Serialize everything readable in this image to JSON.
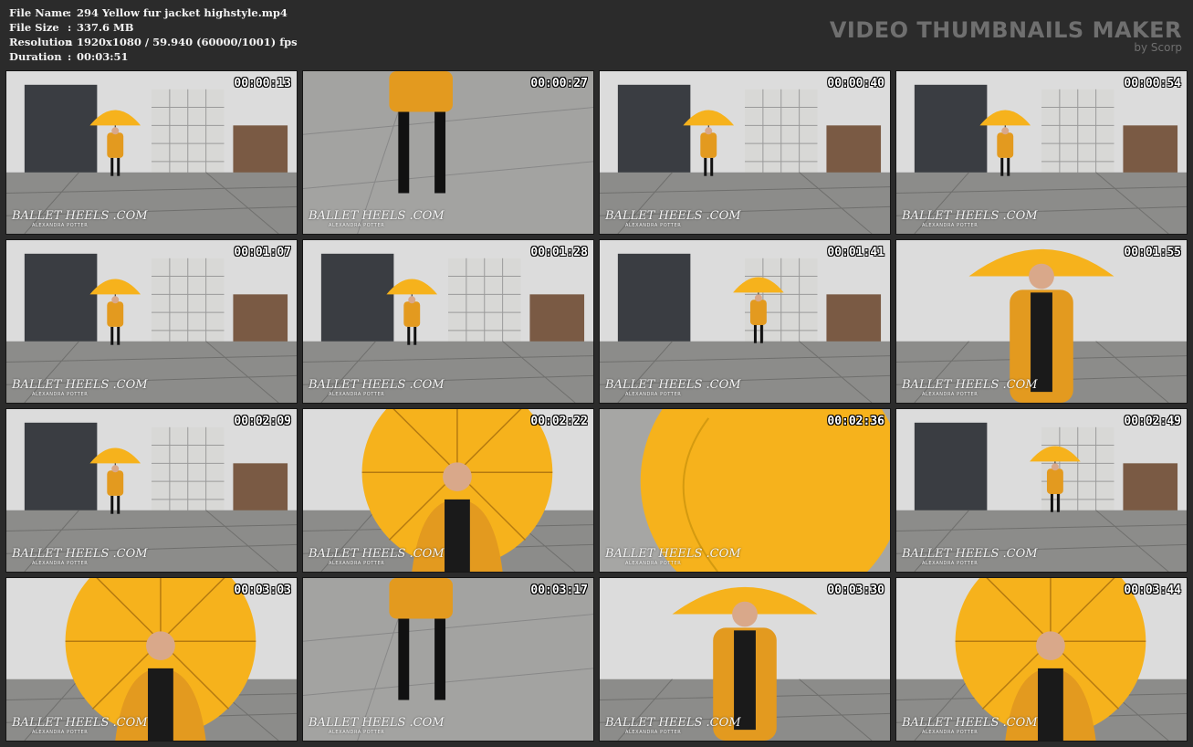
{
  "file_info": {
    "file_name": {
      "label": "File Name",
      "sep": ":",
      "value": "294 Yellow fur jacket highstyle.mp4"
    },
    "file_size": {
      "label": "File Size",
      "sep": ":",
      "value": "337.6 MB"
    },
    "resolution": {
      "label": "Resolution",
      "sep": ":",
      "value": "1920x1080 / 59.940 (60000/1001) fps"
    },
    "duration": {
      "label": "Duration",
      "sep": ":",
      "value": "00:03:51"
    }
  },
  "branding": {
    "title": "VIDEO THUMBNAILS MAKER",
    "subtitle": "by Scorp"
  },
  "watermark": {
    "logo": "BALLET HEELS .COM",
    "tagline": "ALEXANDRA POTTER"
  },
  "thumbnails": [
    {
      "time": "00:00:13",
      "scene": "wide"
    },
    {
      "time": "00:00:27",
      "scene": "legs"
    },
    {
      "time": "00:00:40",
      "scene": "wide"
    },
    {
      "time": "00:00:54",
      "scene": "wide"
    },
    {
      "time": "00:01:07",
      "scene": "wide"
    },
    {
      "time": "00:01:28",
      "scene": "wide"
    },
    {
      "time": "00:01:41",
      "scene": "back"
    },
    {
      "time": "00:01:55",
      "scene": "mid"
    },
    {
      "time": "00:02:09",
      "scene": "wide"
    },
    {
      "time": "00:02:22",
      "scene": "closeup"
    },
    {
      "time": "00:02:36",
      "scene": "umbrella"
    },
    {
      "time": "00:02:49",
      "scene": "back"
    },
    {
      "time": "00:03:03",
      "scene": "closeup"
    },
    {
      "time": "00:03:17",
      "scene": "legs"
    },
    {
      "time": "00:03:30",
      "scene": "mid"
    },
    {
      "time": "00:03:44",
      "scene": "closeup"
    }
  ],
  "colors": {
    "background": "#2b2b2b",
    "umbrella": "#f6b21c",
    "coat": "#e39a1f",
    "sky": "#dcdcdc",
    "ground": "#8c8c8a"
  }
}
